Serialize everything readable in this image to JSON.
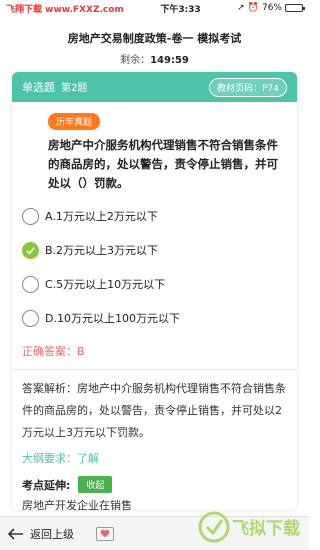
{
  "statusbar": {
    "watermark_left": "飞翔下载 www.FXXZ.com",
    "time": "下午3:33",
    "battery": "76%",
    "battery_level": 0.76
  },
  "header": {
    "title": "房地产交易制度政策-卷一 模拟考试",
    "timer_label": "剩余：",
    "timer_value": "149:59"
  },
  "question_card": {
    "type_label": "单选题",
    "number_label": "第2题",
    "page_ref": "教材页码：P74",
    "tag": "历年真题",
    "question_text": "房地产中介服务机构代理销售不符合销售条件的商品房的，处以警告，责令停止销售，并可处以（）罚款。",
    "options": [
      {
        "label": "A.1万元以上2万元以下",
        "selected": false
      },
      {
        "label": "B.2万元以上3万元以下",
        "selected": true
      },
      {
        "label": "C.5万元以上10万元以下",
        "selected": false
      },
      {
        "label": "D.10万元以上100万元以下",
        "selected": false
      }
    ],
    "correct_answer": "正确答案：B",
    "analysis": "答案解析：房地产中介服务机构代理销售不符合销售条件的商品房的，处以警告，责令停止销售，并可处以2万元以上3万元以下罚款。",
    "outline": "大纲要求：了解",
    "extension_label": "考点延伸:",
    "collapse_label": "收起",
    "extension_text": "房地产开发企业在销售"
  },
  "bottombar": {
    "back_label": "返回上级"
  },
  "watermark": "飞拟下载",
  "colors": {
    "accent": "#4fc3a7",
    "tag": "#ff7a1f",
    "selected": "#8cc63f",
    "answer": "#e46b6b"
  }
}
